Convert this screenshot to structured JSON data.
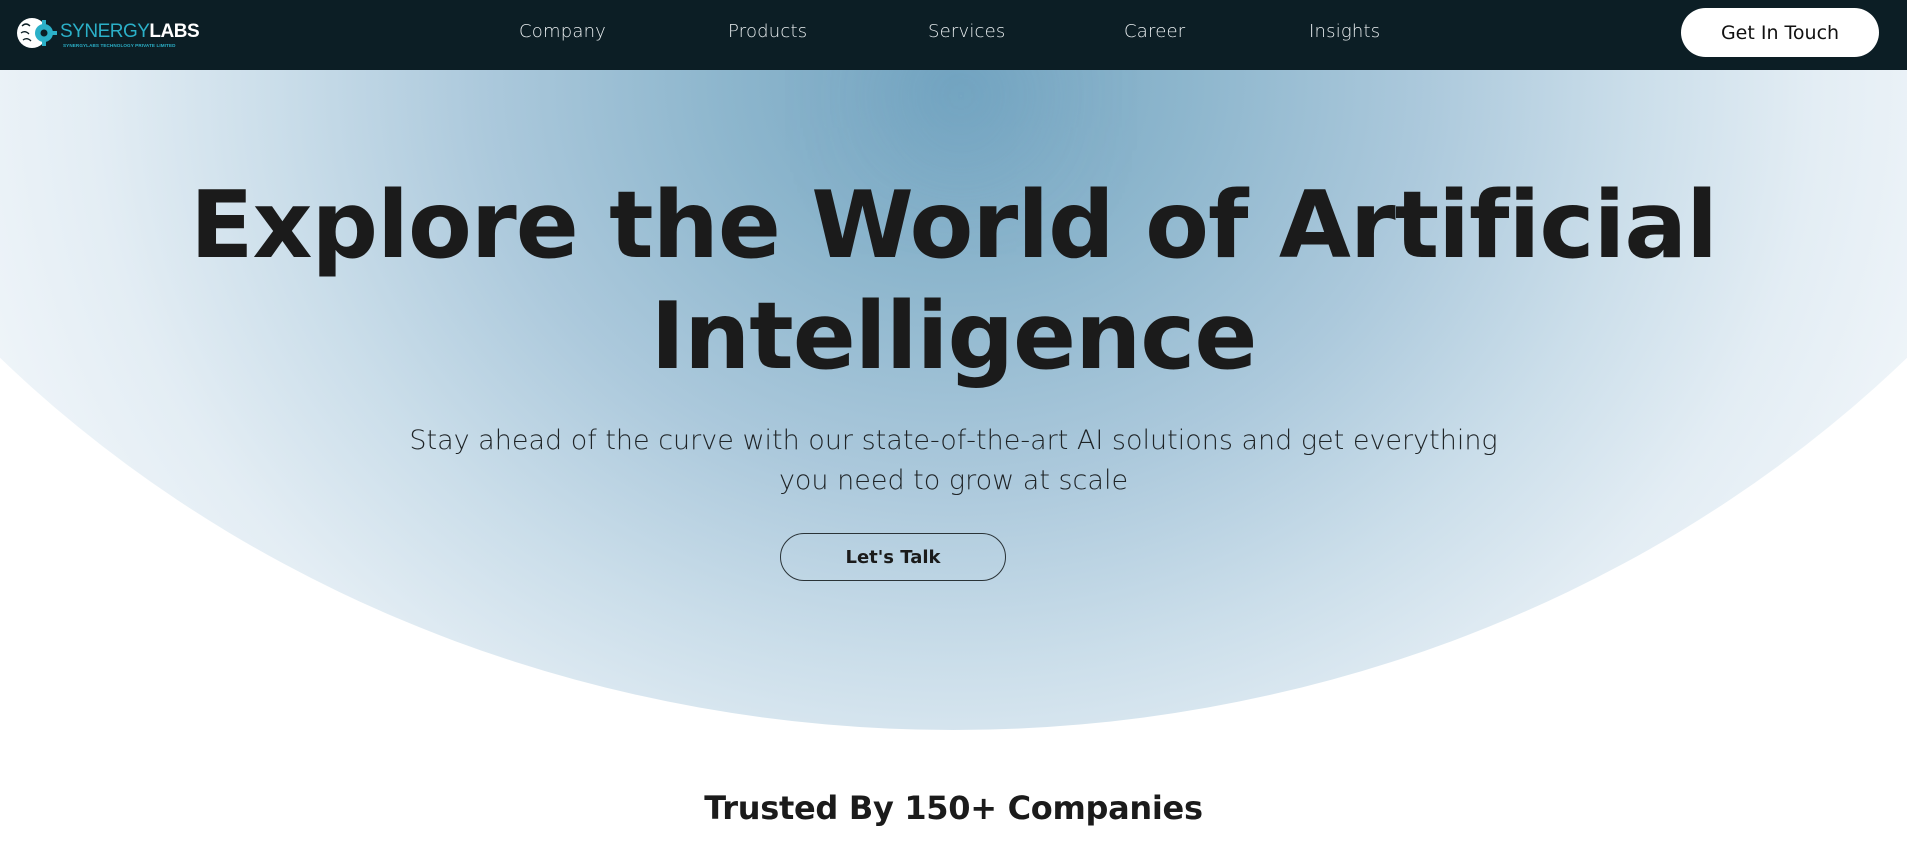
{
  "header": {
    "logo": {
      "word_part1": "SYNERGY",
      "word_part2": "LABS",
      "tagline": "SYNERGYLABS TECHNOLOGY PRIVATE LIMITED",
      "icon": "brain-gear-icon"
    },
    "nav": [
      {
        "label": "Company"
      },
      {
        "label": "Products"
      },
      {
        "label": "Services"
      },
      {
        "label": "Career"
      },
      {
        "label": "Insights"
      }
    ],
    "cta_label": "Get In Touch"
  },
  "hero": {
    "headline_line1": "Explore the World of Artificial",
    "headline_line2": "Intelligence",
    "subtitle_line1": "Stay ahead of the curve with our state-of-the-art AI solutions and get everything",
    "subtitle_line2": "you need to grow at scale",
    "button_label": "Let's Talk"
  },
  "trusted": {
    "heading": "Trusted By 150+ Companies"
  },
  "colors": {
    "header_bg": "#0c1e25",
    "brand_teal": "#2bb0c8",
    "hero_center": "#75a5c1",
    "text_dark": "#1b1b1b"
  }
}
